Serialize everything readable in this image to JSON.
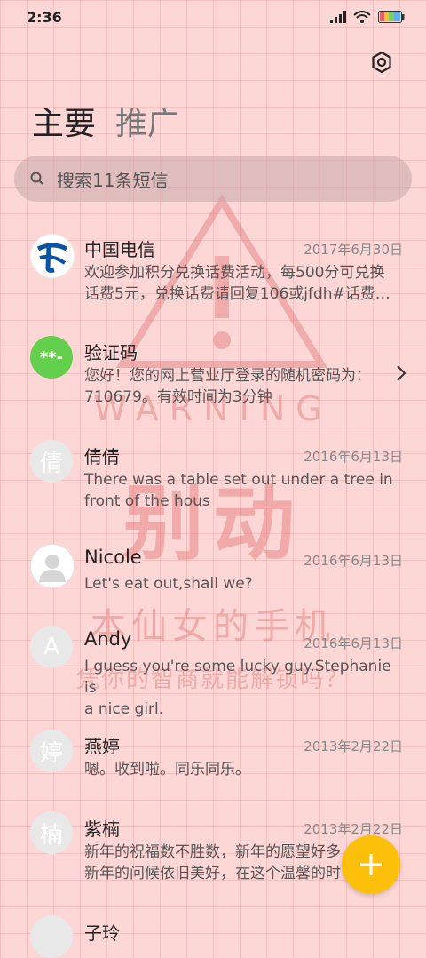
{
  "status_bar": {
    "time": "2:36"
  },
  "tabs": [
    {
      "label": "主要"
    },
    {
      "label": "推广"
    }
  ],
  "search": {
    "placeholder": "搜索11条短信"
  },
  "wallpaper": {
    "warning": "WARNING",
    "big": "别动",
    "line1": "本仙女的手机",
    "line2": "凭你的智商就能解锁吗？"
  },
  "conversations": [
    {
      "name": "中国电信",
      "date": "2017年6月30日",
      "preview": "欢迎参加积分兑换话费活动，每500分可兑换\n话费5元，兑换话费请回复106或jfdh#话费…",
      "avatar": "china-telecom-logo"
    },
    {
      "name": "验证码",
      "date": "",
      "preview": "您好！您的网上营业厅登录的随机密码为：\n710679。有效时间为3分钟",
      "avatar_text": "**-"
    },
    {
      "name": "倩倩",
      "date": "2016年6月13日",
      "preview": "There was a table set out under a tree in\nfront of the hous",
      "avatar_text": "倩"
    },
    {
      "name": "Nicole",
      "date": "2016年6月13日",
      "preview": "Let's eat out,shall we?",
      "avatar": "person-icon"
    },
    {
      "name": "Andy",
      "date": "2016年6月13日",
      "preview": "I guess you're some lucky guy.Stephanie is\na nice girl.",
      "avatar_text": "A"
    },
    {
      "name": "燕婷",
      "date": "2013年2月22日",
      "preview": "嗯。收到啦。同乐同乐。",
      "avatar_text": "婷"
    },
    {
      "name": "紫楠",
      "date": "2013年2月22日",
      "preview": "新年的祝福数不胜数，新年的愿望好多\n新年的问候依旧美好，在这个温馨的时",
      "avatar_text": "楠"
    },
    {
      "name": "子玲",
      "date": "",
      "preview": "",
      "avatar_text": ""
    }
  ],
  "colors": {
    "background": "#fdd6d6",
    "fab": "#fcc00b",
    "verification_avatar": "#64cf4c",
    "telecom_blue": "#0a52a3"
  }
}
